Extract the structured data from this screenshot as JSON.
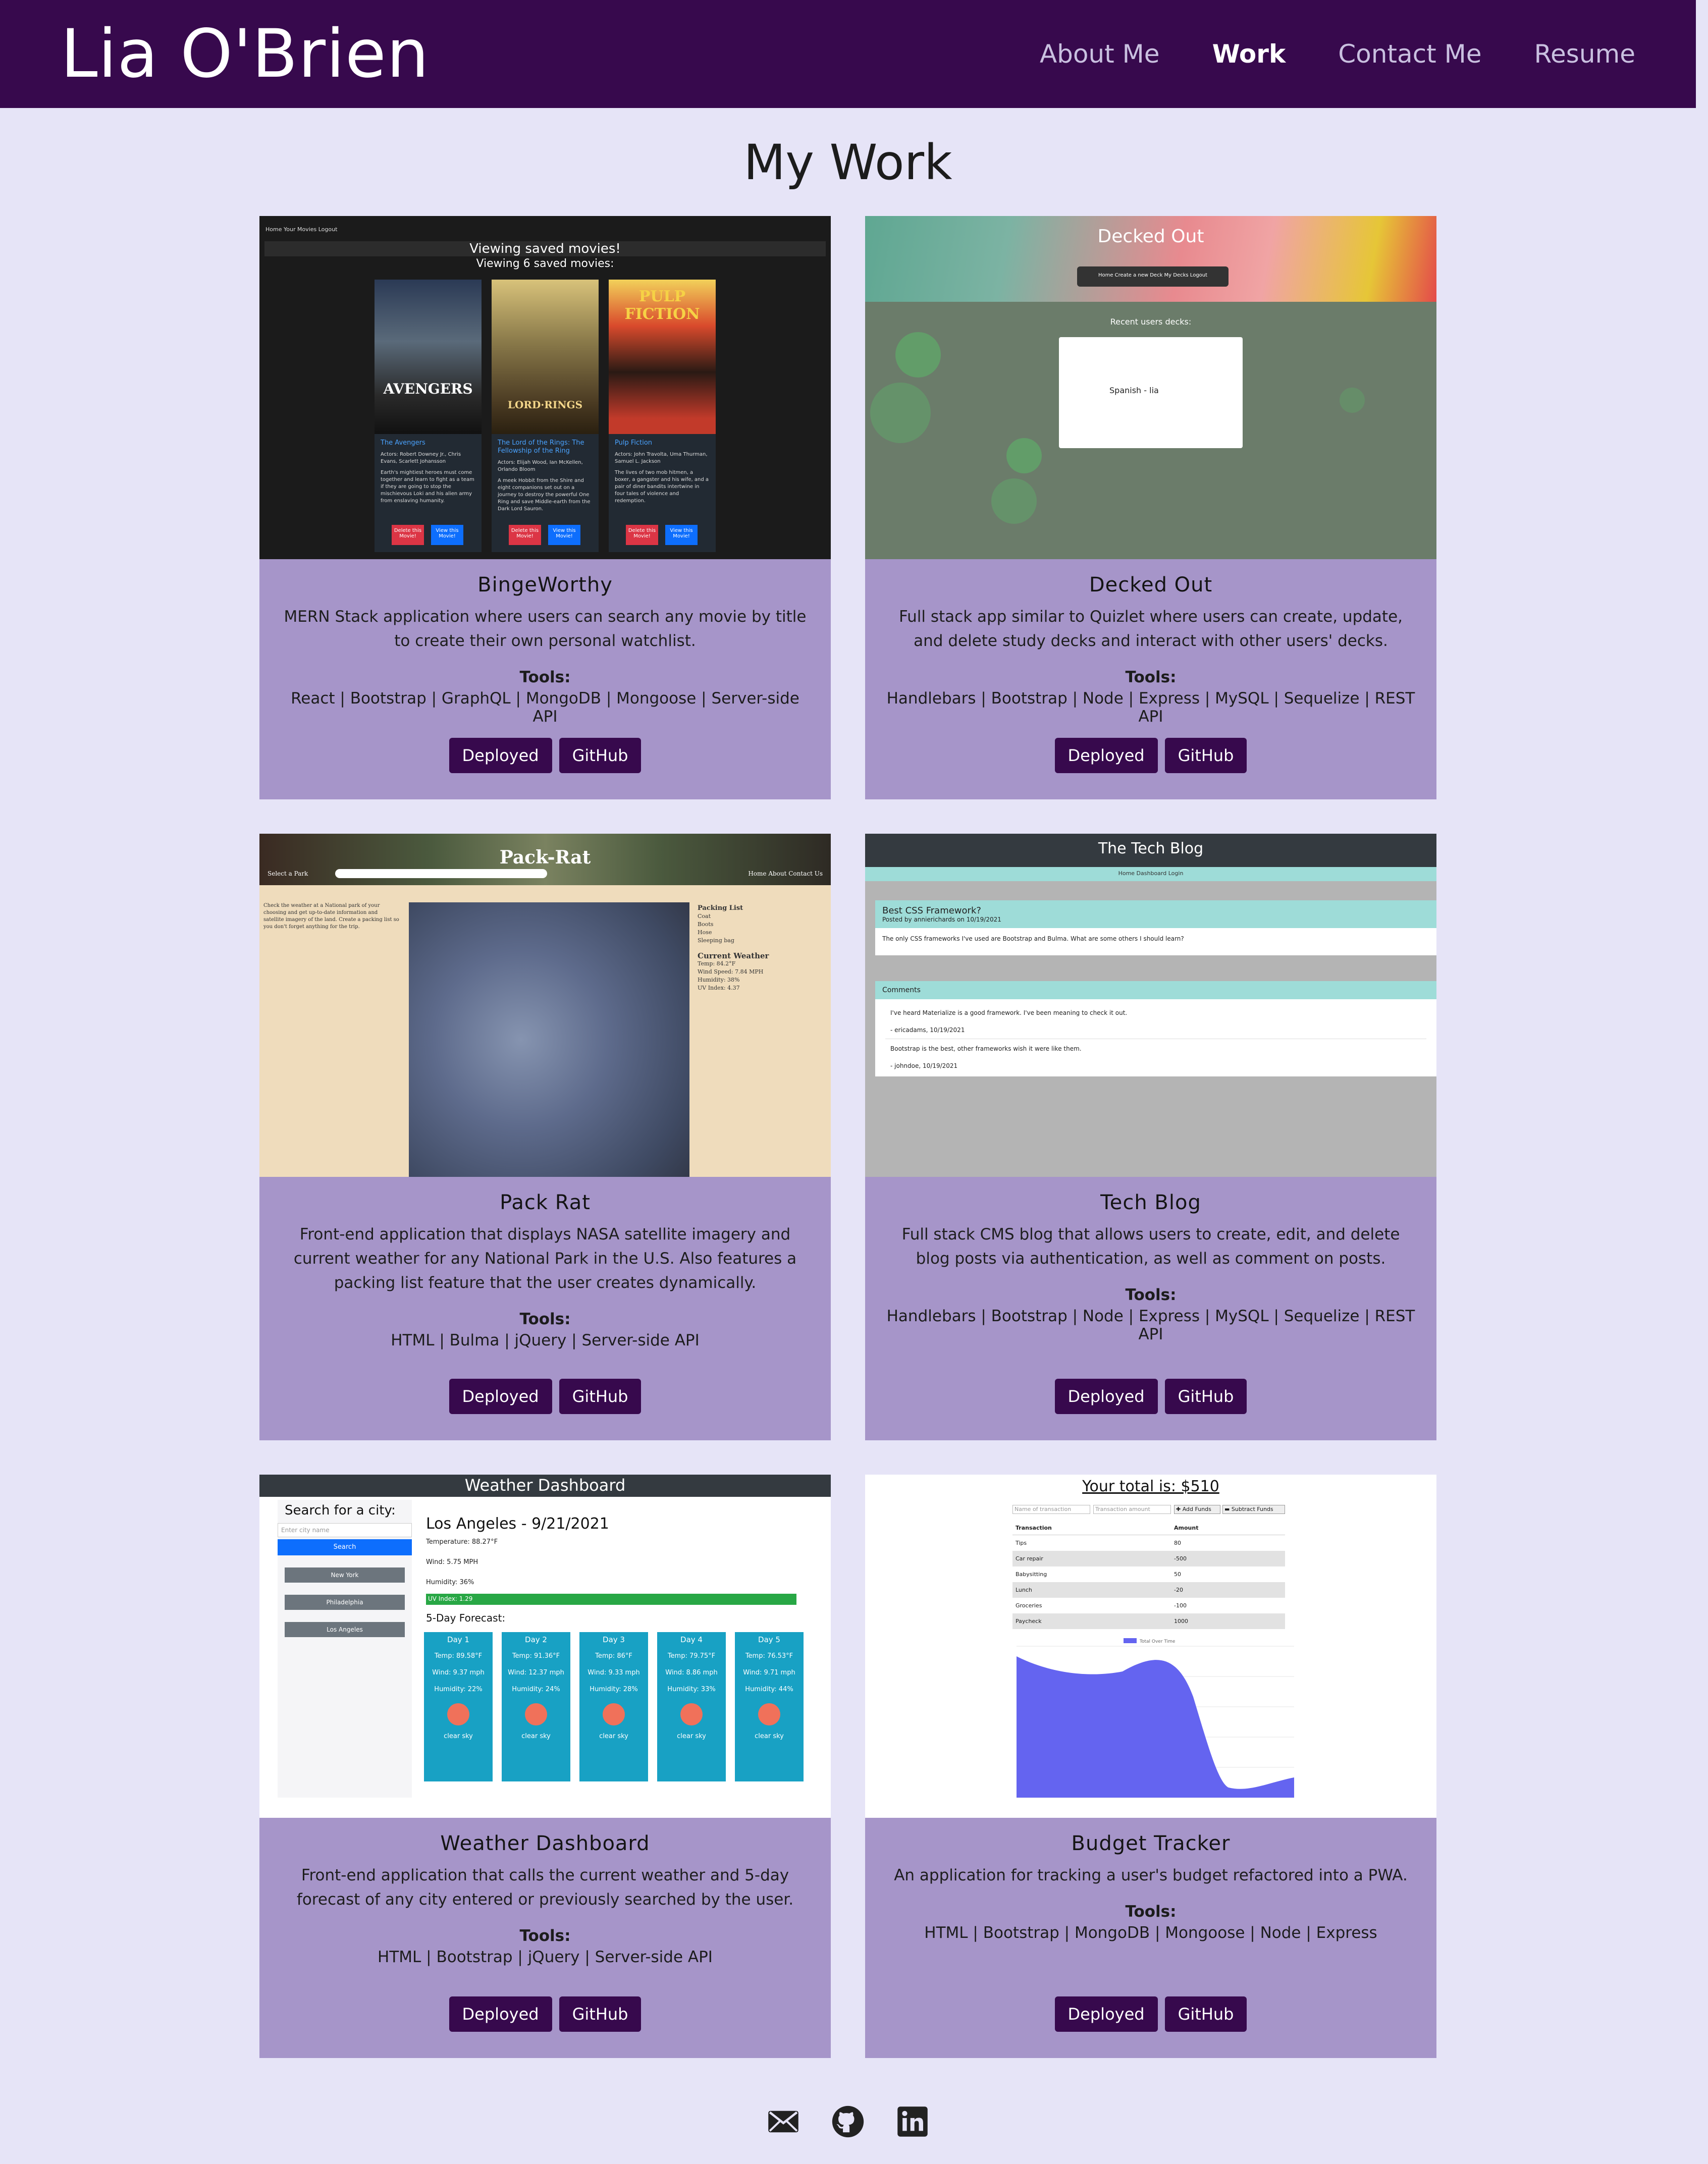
{
  "header": {
    "brand": "Lia O'Brien",
    "nav": [
      "About Me",
      "Work",
      "Contact Me",
      "Resume"
    ]
  },
  "main": {
    "title": "My Work",
    "tools_label": "Tools:",
    "projects": [
      {
        "title": "BingeWorthy",
        "desc": "MERN Stack application where users can search any movie by title to create their own personal watchlist.",
        "tools": "React | Bootstrap | GraphQL | MongoDB | Mongoose | Server-side API",
        "deployed": "Deployed",
        "github": "GitHub"
      },
      {
        "title": "Decked Out",
        "desc": "Full stack app similar to Quizlet where users can create, update, and delete study decks and interact with other users' decks.",
        "tools": "Handlebars | Bootstrap | Node | Express | MySQL | Sequelize | REST API",
        "deployed": "Deployed",
        "github": "GitHub"
      },
      {
        "title": "Pack Rat",
        "desc": "Front-end application that displays NASA satellite imagery and current weather for any National Park in the U.S. Also features a packing list feature that the user creates dynamically.",
        "tools": "HTML | Bulma | jQuery | Server-side API",
        "deployed": "Deployed",
        "github": "GitHub"
      },
      {
        "title": "Tech Blog",
        "desc": "Full stack CMS blog that allows users to create, edit, and delete blog posts via authentication, as well as comment on posts.",
        "tools": "Handlebars | Bootstrap | Node | Express | MySQL | Sequelize | REST API",
        "deployed": "Deployed",
        "github": "GitHub"
      },
      {
        "title": "Weather Dashboard",
        "desc": "Front-end application that calls the current weather and 5-day forecast of any city entered or previously searched by the user.",
        "tools": "HTML | Bootstrap | jQuery | Server-side API",
        "deployed": "Deployed",
        "github": "GitHub"
      },
      {
        "title": "Budget Tracker",
        "desc": "An application for tracking a user's budget refactored into a PWA.",
        "tools": "HTML | Bootstrap | MongoDB | Mongoose | Node | Express",
        "deployed": "Deployed",
        "github": "GitHub"
      }
    ]
  },
  "shots": {
    "bingeworthy": {
      "nav": "Home   Your Movies   Logout",
      "banner": "Viewing saved movies!",
      "sub": "Viewing 6 saved movies:",
      "movies": [
        {
          "title": "The Avengers",
          "actors": "Actors: Robert Downey Jr., Chris Evans, Scarlett Johansson",
          "plot": "Earth's mightiest heroes must come together and learn to fight as a team if they are going to stop the mischievous Loki and his alien army from enslaving humanity."
        },
        {
          "title": "The Lord of the Rings: The Fellowship of the Ring",
          "actors": "Actors: Elijah Wood, Ian McKellen, Orlando Bloom",
          "plot": "A meek Hobbit from the Shire and eight companions set out on a journey to destroy the powerful One Ring and save Middle-earth from the Dark Lord Sauron."
        },
        {
          "title": "Pulp Fiction",
          "actors": "Actors: John Travolta, Uma Thurman, Samuel L. Jackson",
          "plot": "The lives of two mob hitmen, a boxer, a gangster and his wife, and a pair of diner bandits intertwine in four tales of violence and redemption."
        }
      ],
      "delete": "Delete this Movie!",
      "view": "View this Movie!"
    },
    "decked": {
      "title": "Decked Out",
      "menu": "Home    Create a new Deck    My Decks    Logout",
      "recent": "Recent users decks:",
      "deck": "Spanish - lia"
    },
    "packrat": {
      "title": "Pack-Rat",
      "select": "Select a Park",
      "nav": "Home   About   Contact Us",
      "intro": "Check the weather at a National park of your choosing and get up-to-date information and satellite imagery of the land. Create a packing list so you don't forget anything for the trip.",
      "packing": "Packing List",
      "items": [
        "Coat",
        "Boots",
        "Hose",
        "Sleeping bag"
      ],
      "weather": "Current Weather",
      "stats": [
        "Temp: 84.2°F",
        "Wind Speed: 7.84 MPH",
        "Humidity: 38%",
        "UV Index: 4.37"
      ]
    },
    "techblog": {
      "title": "The Tech Blog",
      "nav": "Home    Dashboard    Login",
      "post_title": "Best CSS Framework?",
      "post_by": "Posted by annierichards on 10/19/2021",
      "post_body": "The only CSS frameworks I've used are Bootstrap and Bulma. What are some others I should learn?",
      "comments": "Comments",
      "c1": "I've heard Materialize is a good framework. I've been meaning to check it out.",
      "c1by": "- ericadams, 10/19/2021",
      "c2": "Bootstrap is the best, other frameworks wish it were like them.",
      "c2by": "- johndoe, 10/19/2021"
    },
    "weather": {
      "title": "Weather Dashboard",
      "search_label": "Search for a city:",
      "placeholder": "Enter city name",
      "search_btn": "Search",
      "cities": [
        "New York",
        "Philadelphia",
        "Los Angeles"
      ],
      "city": "Los Angeles - 9/21/2021",
      "temp": "Temperature: 88.27°F",
      "wind": "Wind: 5.75 MPH",
      "humidity": "Humidity: 36%",
      "uv": "UV Index: 1.29",
      "forecast_label": "5-Day Forecast:",
      "days": [
        {
          "day": "Day 1",
          "temp": "Temp: 89.58°F",
          "wind": "Wind: 9.37 mph",
          "hum": "Humidity: 22%",
          "desc": "clear sky"
        },
        {
          "day": "Day 2",
          "temp": "Temp: 91.36°F",
          "wind": "Wind: 12.37 mph",
          "hum": "Humidity: 24%",
          "desc": "clear sky"
        },
        {
          "day": "Day 3",
          "temp": "Temp: 86°F",
          "wind": "Wind: 9.33 mph",
          "hum": "Humidity: 28%",
          "desc": "clear sky"
        },
        {
          "day": "Day 4",
          "temp": "Temp: 79.75°F",
          "wind": "Wind: 8.86 mph",
          "hum": "Humidity: 33%",
          "desc": "clear sky"
        },
        {
          "day": "Day 5",
          "temp": "Temp: 76.53°F",
          "wind": "Wind: 9.71 mph",
          "hum": "Humidity: 44%",
          "desc": "clear sky"
        }
      ]
    },
    "budget": {
      "total": "Your total is: $510",
      "name_ph": "Name of transaction",
      "amount_ph": "Transaction amount",
      "add": "✚ Add Funds",
      "sub": "▬ Subtract Funds",
      "col1": "Transaction",
      "col2": "Amount",
      "rows": [
        [
          "Tips",
          "80"
        ],
        [
          "Car repair",
          "-500"
        ],
        [
          "Babysitting",
          "50"
        ],
        [
          "Lunch",
          "-20"
        ],
        [
          "Groceries",
          "-100"
        ],
        [
          "Paycheck",
          "1000"
        ]
      ],
      "legend": "Total Over Time",
      "chart_color": "#6464f0"
    }
  },
  "footer": {
    "icons": [
      "mail-icon",
      "github-icon",
      "linkedin-icon"
    ]
  },
  "colors": {
    "header": "#37094d",
    "card": "#a695c9",
    "page": "#e6e4f7",
    "button": "#37094d"
  }
}
